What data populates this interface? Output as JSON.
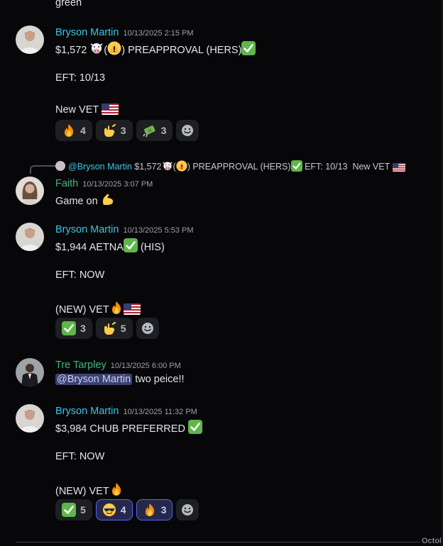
{
  "top_fragment": "green",
  "messages": [
    {
      "author": "Bryson Martin",
      "timestamp": "10/13/2025 2:15 PM",
      "lines": [
        "$1,572",
        "(",
        ") PREAPPROVAL (HERS)",
        "EFT: 10/13",
        "New VET"
      ],
      "reactions": [
        {
          "emoji": "fire",
          "count": "4"
        },
        {
          "emoji": "call-me-hand",
          "count": "3"
        },
        {
          "emoji": "money-with-wings",
          "count": "3"
        }
      ]
    },
    {
      "author": "Faith",
      "timestamp": "10/13/2025 3:07 PM",
      "reply": {
        "mention": "@Bryson Martin",
        "text1": "$1,572",
        "text2": "(",
        "text3": ") PREAPPROVAL (HERS)",
        "text4": "EFT: 10/13",
        "text5": "New VET"
      },
      "lines": [
        "Game on"
      ]
    },
    {
      "author": "Bryson Martin",
      "timestamp": "10/13/2025 5:53 PM",
      "lines": [
        "$1,944 AETNA",
        "(HIS)",
        "EFT: NOW",
        "(NEW) VET"
      ],
      "reactions": [
        {
          "emoji": "check",
          "count": "3"
        },
        {
          "emoji": "call-me-hand",
          "count": "5"
        }
      ]
    },
    {
      "author": "Tre Tarpley",
      "timestamp": "10/13/2025 6:00 PM",
      "mention": "@Bryson Martin",
      "text": "two peice!!"
    },
    {
      "author": "Bryson Martin",
      "timestamp": "10/13/2025 11:32 PM",
      "lines": [
        "$3,984 CHUB PREFERRED",
        "EFT: NOW",
        "(NEW) VET"
      ],
      "reactions": [
        {
          "emoji": "check",
          "count": "5"
        },
        {
          "emoji": "sunglasses",
          "count": "4"
        },
        {
          "emoji": "fire",
          "count": "3"
        }
      ]
    }
  ],
  "divider_label": "Octob",
  "colors": {
    "bg": "#070709",
    "name_blue": "#3ec3e6",
    "name_green": "#3bb87a",
    "accent": "#5865f2"
  }
}
